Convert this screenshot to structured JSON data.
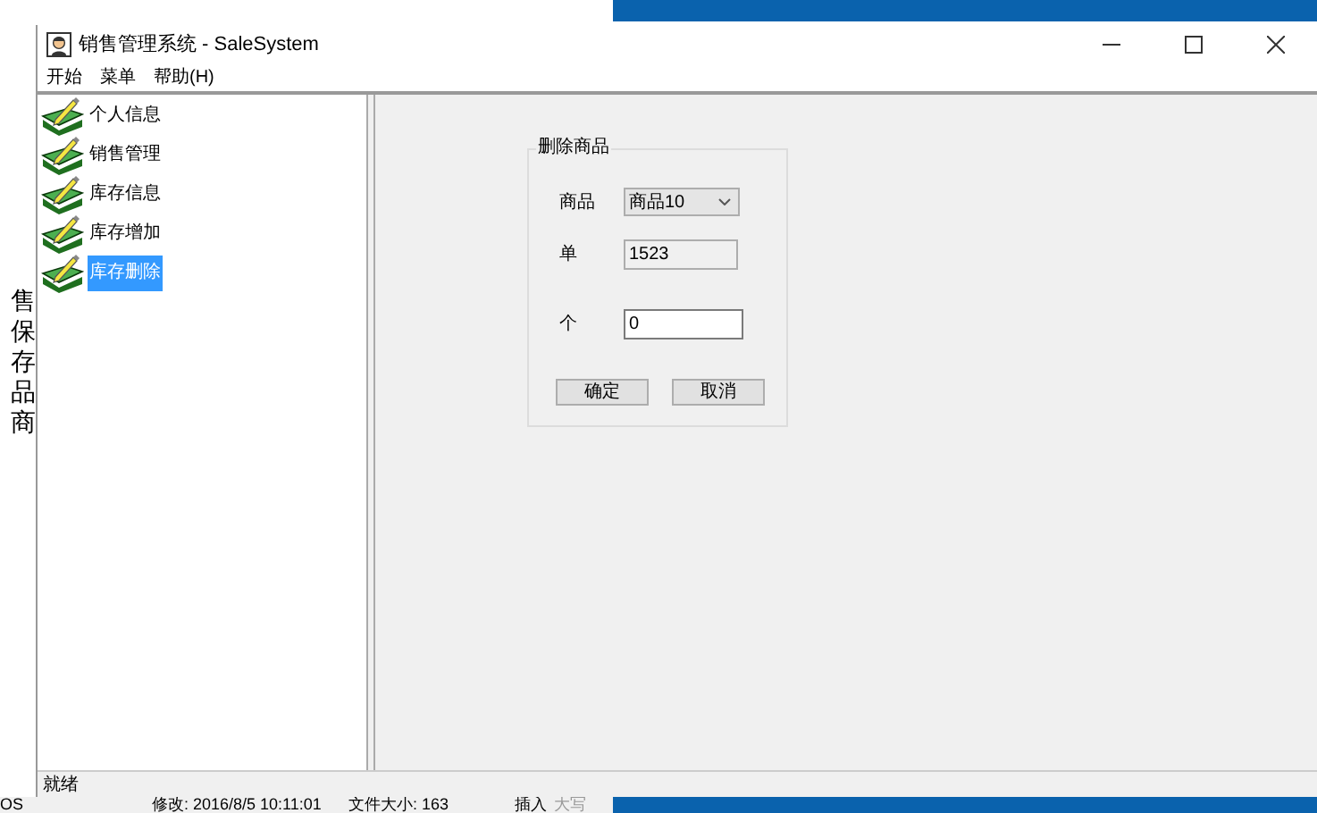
{
  "background": {
    "side_fragments": [
      "售",
      "保",
      "存",
      "品",
      "商"
    ],
    "status_texts": [
      "OS",
      "修改: 2016/8/5 10:11:01",
      "文件大小: 163",
      "插入",
      "大写"
    ]
  },
  "window": {
    "title": "销售管理系统 - SaleSystem"
  },
  "menu": [
    "开始",
    "菜单",
    "帮助(H)"
  ],
  "tree": {
    "items": [
      {
        "label": "个人信息",
        "selected": false
      },
      {
        "label": "销售管理",
        "selected": false
      },
      {
        "label": "库存信息",
        "selected": false
      },
      {
        "label": "库存增加",
        "selected": false
      },
      {
        "label": "库存删除",
        "selected": true
      }
    ]
  },
  "form": {
    "title": "删除商品",
    "fields": [
      {
        "kind": "combo",
        "label": "商品",
        "value": "商品10"
      },
      {
        "kind": "readonly",
        "label": "单",
        "value": "1523"
      },
      {
        "kind": "input",
        "label": "个",
        "value": "0"
      }
    ],
    "buttons": [
      "确定",
      "取消"
    ]
  },
  "status_bar": "就绪"
}
